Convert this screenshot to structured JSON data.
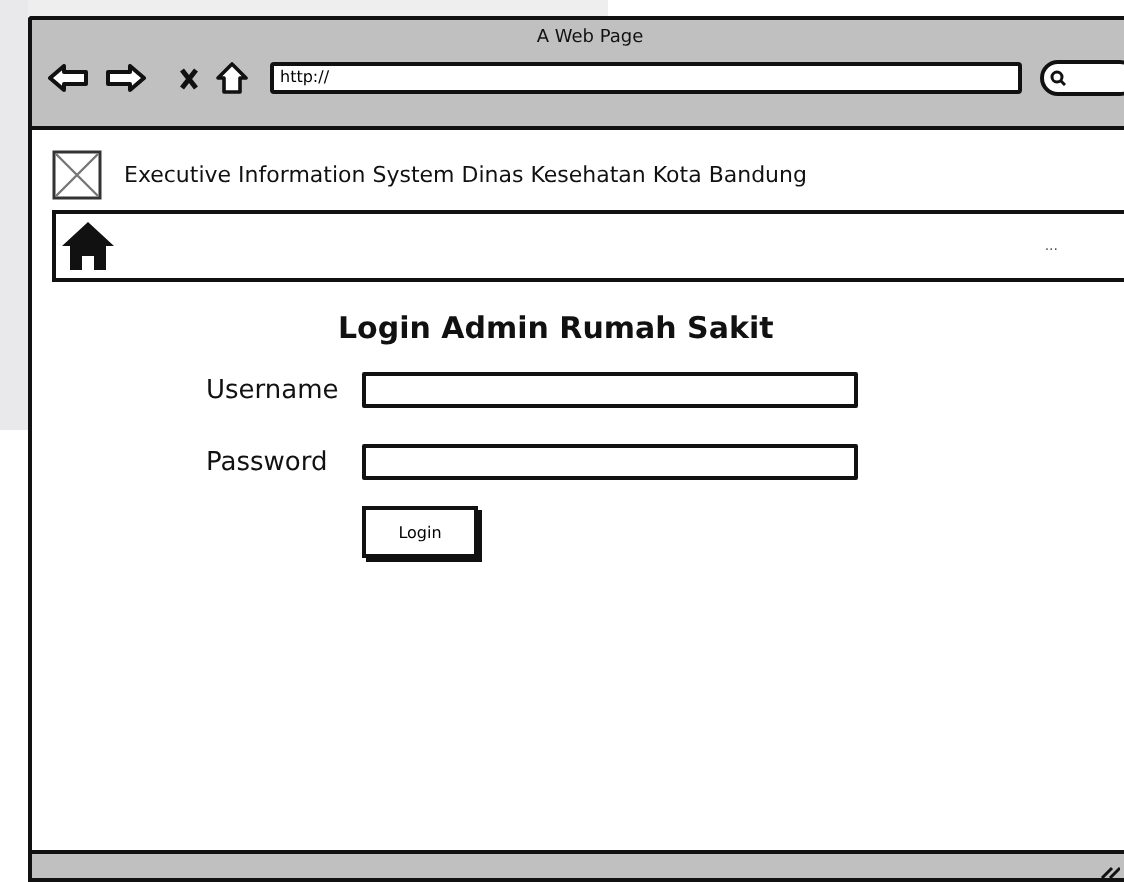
{
  "window": {
    "title": "A Web Page"
  },
  "address_bar": {
    "value": "http://"
  },
  "header": {
    "title": "Executive Information System Dinas Kesehatan Kota Bandung"
  },
  "nav_bar": {
    "text": "..."
  },
  "login_form": {
    "title": "Login Admin Rumah Sakit",
    "fields": [
      {
        "label": "Username"
      },
      {
        "label": "Password"
      }
    ],
    "button": "Login"
  }
}
